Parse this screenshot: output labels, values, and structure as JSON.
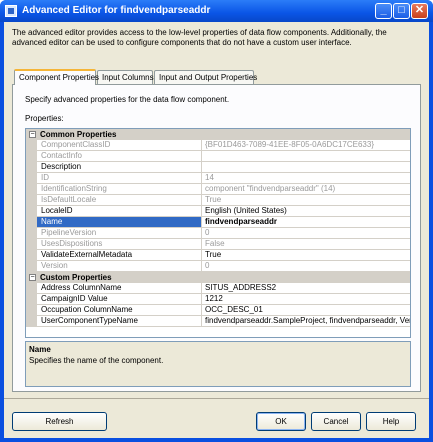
{
  "window": {
    "title": "Advanced Editor for findvendparseaddr",
    "minimize": "_",
    "maximize": "□",
    "close": "✕"
  },
  "description": "The advanced editor provides access to the low-level properties of data flow components. Additionally, the advanced editor can be used to configure components that do not have a custom user interface.",
  "tabs": [
    {
      "label": "Component Properties",
      "active": true
    },
    {
      "label": "Input Columns",
      "active": false
    },
    {
      "label": "Input and Output Properties",
      "active": false
    }
  ],
  "panel": {
    "instruction": "Specify advanced properties for the data flow component.",
    "properties_label": "Properties:"
  },
  "grid": {
    "common": {
      "label": "Common Properties",
      "expander": "−",
      "rows": [
        {
          "name": "ComponentClassID",
          "value": "{BF01D463-7089-41EE-8F05-0A6DC17CE633}"
        },
        {
          "name": "ContactInfo",
          "value": ""
        },
        {
          "name": "Description",
          "value": ""
        },
        {
          "name": "ID",
          "value": "14"
        },
        {
          "name": "IdentificationString",
          "value": "component \"findvendparseaddr\" (14)"
        },
        {
          "name": "IsDefaultLocale",
          "value": "True"
        },
        {
          "name": "LocaleID",
          "value": "English (United States)"
        },
        {
          "name": "Name",
          "value": "findvendparseaddr"
        },
        {
          "name": "PipelineVersion",
          "value": "0"
        },
        {
          "name": "UsesDispositions",
          "value": "False"
        },
        {
          "name": "ValidateExternalMetadata",
          "value": "True"
        },
        {
          "name": "Version",
          "value": "0"
        }
      ]
    },
    "custom": {
      "label": "Custom Properties",
      "expander": "−",
      "rows": [
        {
          "name": "Address ColumnName",
          "value": "SITUS_ADDRESS2"
        },
        {
          "name": "CampaignID Value",
          "value": "1212"
        },
        {
          "name": "Occupation ColumnName",
          "value": "OCC_DESC_01"
        },
        {
          "name": "UserComponentTypeName",
          "value": "findvendparseaddr.SampleProject, findvendparseaddr, Vers"
        }
      ]
    }
  },
  "help": {
    "title": "Name",
    "text": "Specifies the name of the component."
  },
  "buttons": {
    "refresh": "Refresh",
    "ok": "OK",
    "cancel": "Cancel",
    "help": "Help"
  }
}
